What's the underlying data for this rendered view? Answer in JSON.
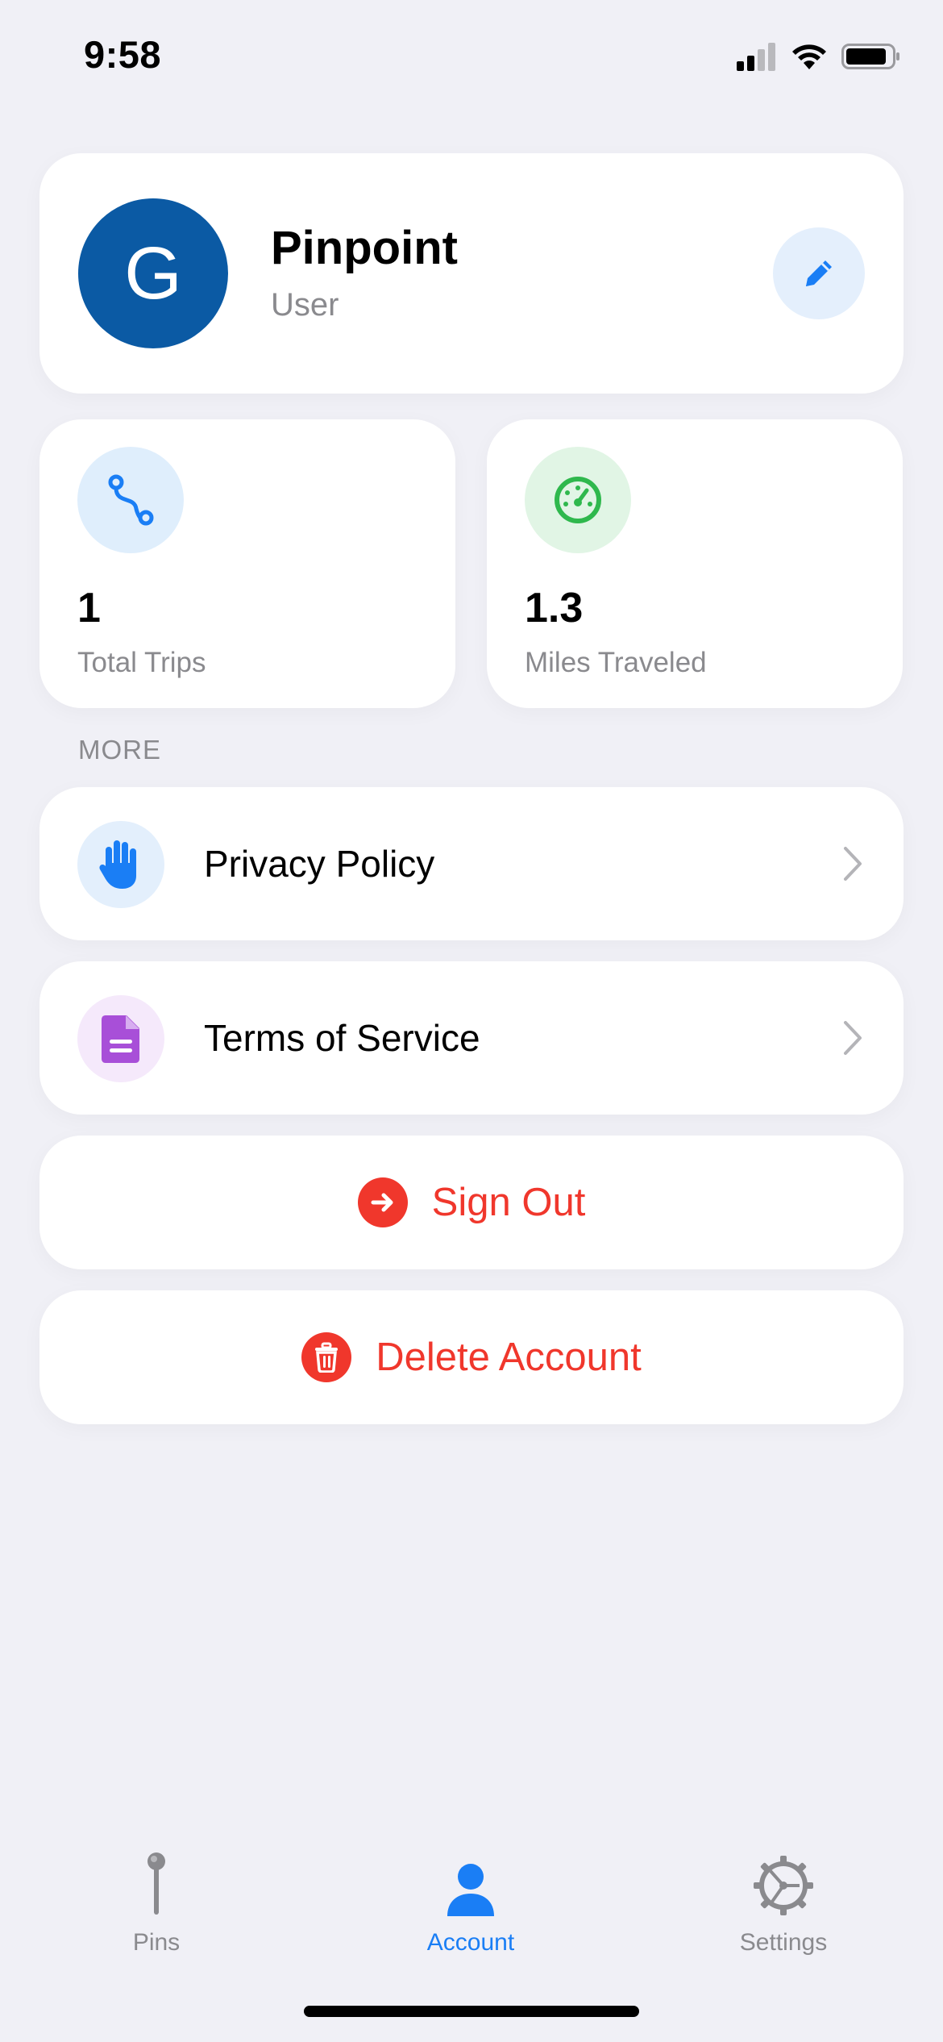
{
  "status_bar": {
    "time": "9:58",
    "icons": [
      "signal-icon",
      "wifi-icon",
      "battery-icon"
    ]
  },
  "profile": {
    "avatar_initial": "G",
    "name": "Pinpoint",
    "role": "User",
    "edit_icon": "pencil-icon",
    "avatar_color": "#0b5aa4"
  },
  "stats": [
    {
      "value": "1",
      "label": "Total Trips",
      "icon": "route-icon",
      "icon_color": "#1a7ef5",
      "icon_bg": "#dfeefc"
    },
    {
      "value": "1.3",
      "label": "Miles Traveled",
      "icon": "speedometer-icon",
      "icon_color": "#2fb84d",
      "icon_bg": "#e1f5e5"
    }
  ],
  "more": {
    "section_label": "MORE",
    "items": [
      {
        "label": "Privacy Policy",
        "icon": "hand-icon",
        "icon_color": "#1a7ef5",
        "icon_bg": "#e3effc"
      },
      {
        "label": "Terms of Service",
        "icon": "document-icon",
        "icon_color": "#a84fd8",
        "icon_bg": "#f5e9fb"
      }
    ]
  },
  "actions": {
    "sign_out": {
      "label": "Sign Out",
      "icon": "arrow-right-circle-icon"
    },
    "delete_account": {
      "label": "Delete Account",
      "icon": "trash-icon"
    },
    "destructive_color": "#f0372c"
  },
  "tab_bar": {
    "tabs": [
      {
        "label": "Pins",
        "icon": "pin-icon",
        "active": false
      },
      {
        "label": "Account",
        "icon": "person-icon",
        "active": true
      },
      {
        "label": "Settings",
        "icon": "gear-icon",
        "active": false
      }
    ],
    "active_color": "#1a7ef5"
  }
}
